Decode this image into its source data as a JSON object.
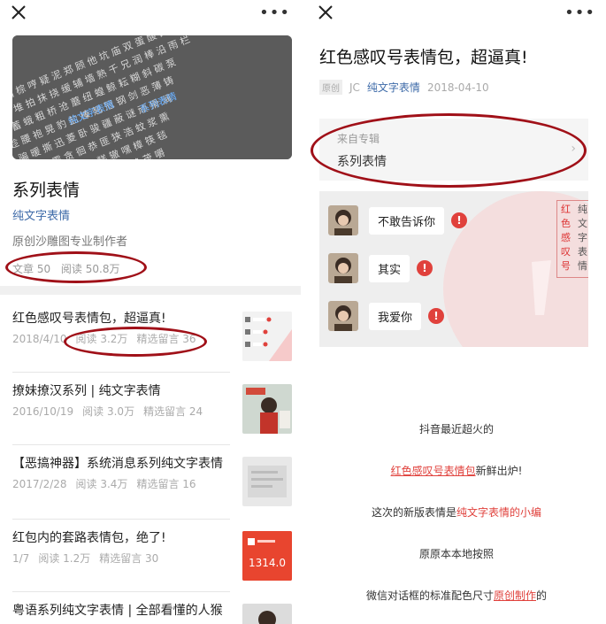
{
  "left": {
    "album_title": "系列表情",
    "author": "纯文字表情",
    "description": "原创沙雕图专业制作者",
    "stats": {
      "articles": "文章 50",
      "reads": "阅读 50.8万"
    },
    "articles": [
      {
        "title": "红色感叹号表情包，超逼真!",
        "date": "2018/4/10",
        "reads": "阅读 3.2万",
        "comments": "精选留言 36"
      },
      {
        "title": "撩妹撩汉系列 | 纯文字表情",
        "date": "2016/10/19",
        "reads": "阅读 3.0万",
        "comments": "精选留言 24"
      },
      {
        "title": "【恶搞神器】系统消息系列纯文字表情",
        "date": "2017/2/28",
        "reads": "阅读 3.4万",
        "comments": "精选留言 16"
      },
      {
        "title": "红包内的套路表情包，绝了!",
        "date": "1/7",
        "reads": "阅读 1.2万",
        "comments": "精选留言 30"
      },
      {
        "title": "粤语系列纯文字表情 | 全部看懂的人猴",
        "date": "",
        "reads": "",
        "comments": ""
      }
    ],
    "redpacket_amount": "1314.0",
    "banner_highlight_1": "纯文字表情",
    "banner_highlight_2": "系列表情"
  },
  "right": {
    "article_title": "红色感叹号表情包，超逼真!",
    "original_badge": "原创",
    "author_initials": "JC",
    "author_name": "纯文字表情",
    "date": "2018-04-10",
    "source_label": "来自专辑",
    "source_value": "系列表情",
    "chat_messages": [
      "不敢告诉你",
      "其实",
      "我爱你"
    ],
    "tag_col1": [
      "红",
      "色",
      "感",
      "叹",
      "号"
    ],
    "tag_col2": [
      "纯",
      "文",
      "字",
      "表",
      "情"
    ],
    "body": {
      "line1": "抖音最近超火的",
      "line2_link": "红色感叹号表情包",
      "line2_rest": "新鲜出炉!",
      "line3_pre": "这次的新版表情是",
      "line3_link": "纯文字表情的小编",
      "line4": "原原本本地按照",
      "line5_pre": "微信对话框的标准配色尺寸",
      "line5_link": "原创制作",
      "line5_post": "的"
    }
  },
  "icons": {
    "close": "close-icon",
    "more": "more-icon",
    "warning": "exclamation-icon",
    "chevron": "chevron-right-icon"
  },
  "colors": {
    "link_blue": "#3d6aa8",
    "accent_red": "#e0413c",
    "annotation_red": "#a01018"
  }
}
